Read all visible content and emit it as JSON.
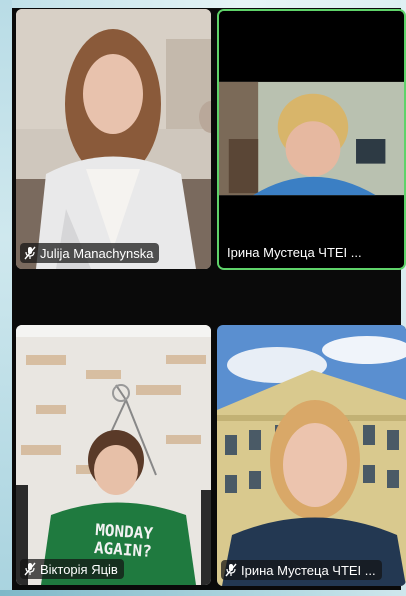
{
  "participants": [
    {
      "name": "Julija Manachynska",
      "mic": "muted-mic-icon"
    },
    {
      "name": "Ірина Мустеца ЧТЕІ ...",
      "mic": "none",
      "active_speaker": true
    },
    {
      "name": "Вікторія Яців",
      "mic": "muted-mic-icon"
    },
    {
      "name": "Ірина Мустеца ЧТЕІ ...",
      "mic": "muted-mic-icon"
    }
  ],
  "shirt_text": {
    "line1": "MONDAY",
    "line2": "AGAIN?"
  },
  "colors": {
    "active_border": "#5fd36a",
    "label_bg": "#141414",
    "background": "#0a0a0a"
  }
}
